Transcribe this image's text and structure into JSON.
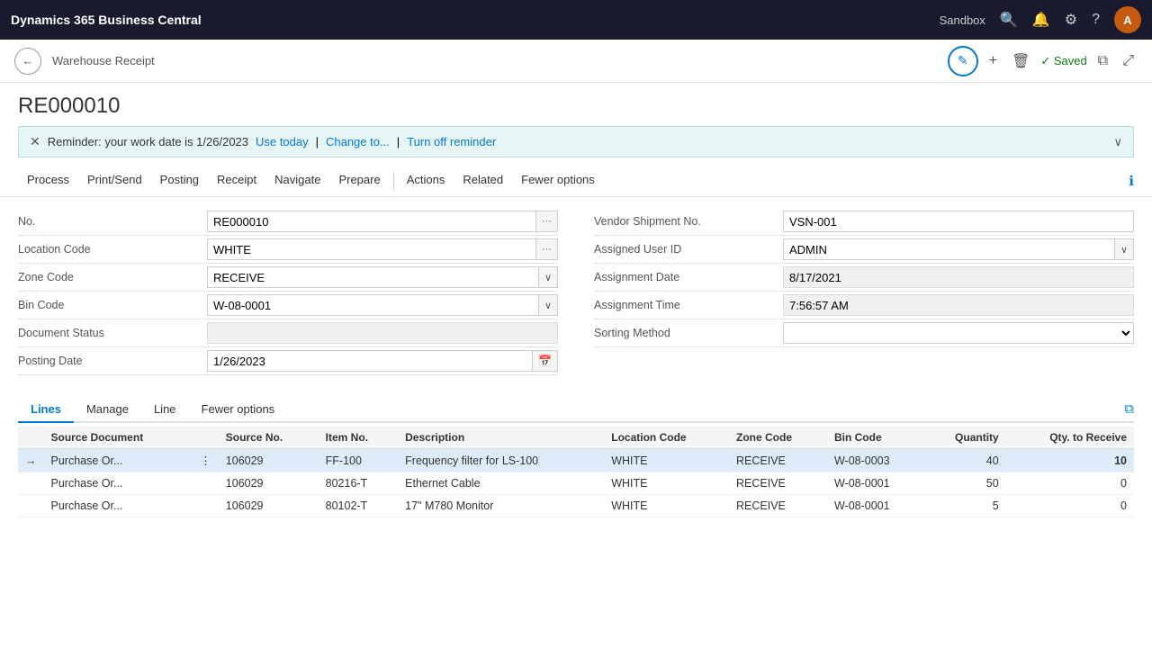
{
  "topbar": {
    "brand": "Dynamics 365 Business Central",
    "sandbox_label": "Sandbox",
    "avatar_initials": "A"
  },
  "page_header": {
    "back_label": "←",
    "title": "Warehouse Receipt",
    "edit_icon": "✎",
    "add_icon": "+",
    "delete_icon": "🗑",
    "saved_label": "✓ Saved",
    "open_icon": "⧉",
    "expand_icon": "⤢"
  },
  "doc_number": "RE000010",
  "reminder": {
    "text": "Reminder: your work date is 1/26/2023",
    "use_today": "Use today",
    "change_to": "Change to...",
    "turn_off": "Turn off reminder"
  },
  "ribbon": {
    "items": [
      "Process",
      "Print/Send",
      "Posting",
      "Receipt",
      "Navigate",
      "Prepare",
      "Actions",
      "Related",
      "Fewer options"
    ]
  },
  "form": {
    "left": [
      {
        "label": "No.",
        "value": "RE000010",
        "type": "input_ellipsis"
      },
      {
        "label": "Location Code",
        "value": "WHITE",
        "type": "input_ellipsis"
      },
      {
        "label": "Zone Code",
        "value": "RECEIVE",
        "type": "dropdown"
      },
      {
        "label": "Bin Code",
        "value": "W-08-0001",
        "type": "dropdown"
      },
      {
        "label": "Document Status",
        "value": "",
        "type": "input_readonly"
      },
      {
        "label": "Posting Date",
        "value": "1/26/2023",
        "type": "input_calendar"
      }
    ],
    "right": [
      {
        "label": "Vendor Shipment No.",
        "value": "VSN-001",
        "type": "input"
      },
      {
        "label": "Assigned User ID",
        "value": "ADMIN",
        "type": "dropdown_select"
      },
      {
        "label": "Assignment Date",
        "value": "8/17/2021",
        "type": "input_readonly"
      },
      {
        "label": "Assignment Time",
        "value": "7:56:57 AM",
        "type": "input_readonly"
      },
      {
        "label": "Sorting Method",
        "value": "",
        "type": "select_empty"
      }
    ]
  },
  "lines": {
    "tabs": [
      "Lines",
      "Manage",
      "Line",
      "Fewer options"
    ],
    "active_tab": "Lines",
    "columns": [
      "Source Document",
      "Source No.",
      "Item No.",
      "Description",
      "Location Code",
      "Zone Code",
      "Bin Code",
      "Quantity",
      "Qty. to Receive"
    ],
    "rows": [
      {
        "arrow": "→",
        "source_document": "Purchase Or...",
        "menu": "⋮",
        "source_no": "106029",
        "item_no": "FF-100",
        "description": "Frequency filter for LS-100",
        "location_code": "WHITE",
        "zone_code": "RECEIVE",
        "bin_code": "W-08-0003",
        "quantity": "40",
        "qty_to_receive": "10",
        "active": true
      },
      {
        "arrow": "",
        "source_document": "Purchase Or...",
        "menu": "",
        "source_no": "106029",
        "item_no": "80216-T",
        "description": "Ethernet Cable",
        "location_code": "WHITE",
        "zone_code": "RECEIVE",
        "bin_code": "W-08-0001",
        "quantity": "50",
        "qty_to_receive": "0",
        "active": false
      },
      {
        "arrow": "",
        "source_document": "Purchase Or...",
        "menu": "",
        "source_no": "106029",
        "item_no": "80102-T",
        "description": "17\" M780 Monitor",
        "location_code": "WHITE",
        "zone_code": "RECEIVE",
        "bin_code": "W-08-0001",
        "quantity": "5",
        "qty_to_receive": "0",
        "active": false
      }
    ]
  }
}
